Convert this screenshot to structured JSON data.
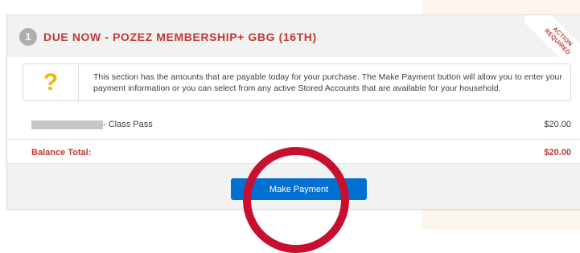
{
  "section": {
    "step_number": "1",
    "title": "DUE NOW - POZEZ MEMBERSHIP+ GBG (16TH)",
    "ribbon_line1": "ACTION",
    "ribbon_line2": "REQUIRED"
  },
  "notice": {
    "icon": "question-mark-icon",
    "icon_glyph": "?",
    "icon_color": "#f4b400",
    "text": "This section has the amounts that are payable today for your purchase. The Make Payment button will allow you to enter your payment information or you can select from any active Stored Accounts that are available for your household."
  },
  "line_items": [
    {
      "name_suffix": "- Class Pass",
      "amount": "$20.00"
    }
  ],
  "balance": {
    "label": "Balance Total:",
    "amount": "$20.00"
  },
  "actions": {
    "make_payment_label": "Make Payment"
  },
  "colors": {
    "accent_red": "#c23934",
    "button_blue": "#0070d2",
    "annotation_circle": "#c8102e"
  }
}
